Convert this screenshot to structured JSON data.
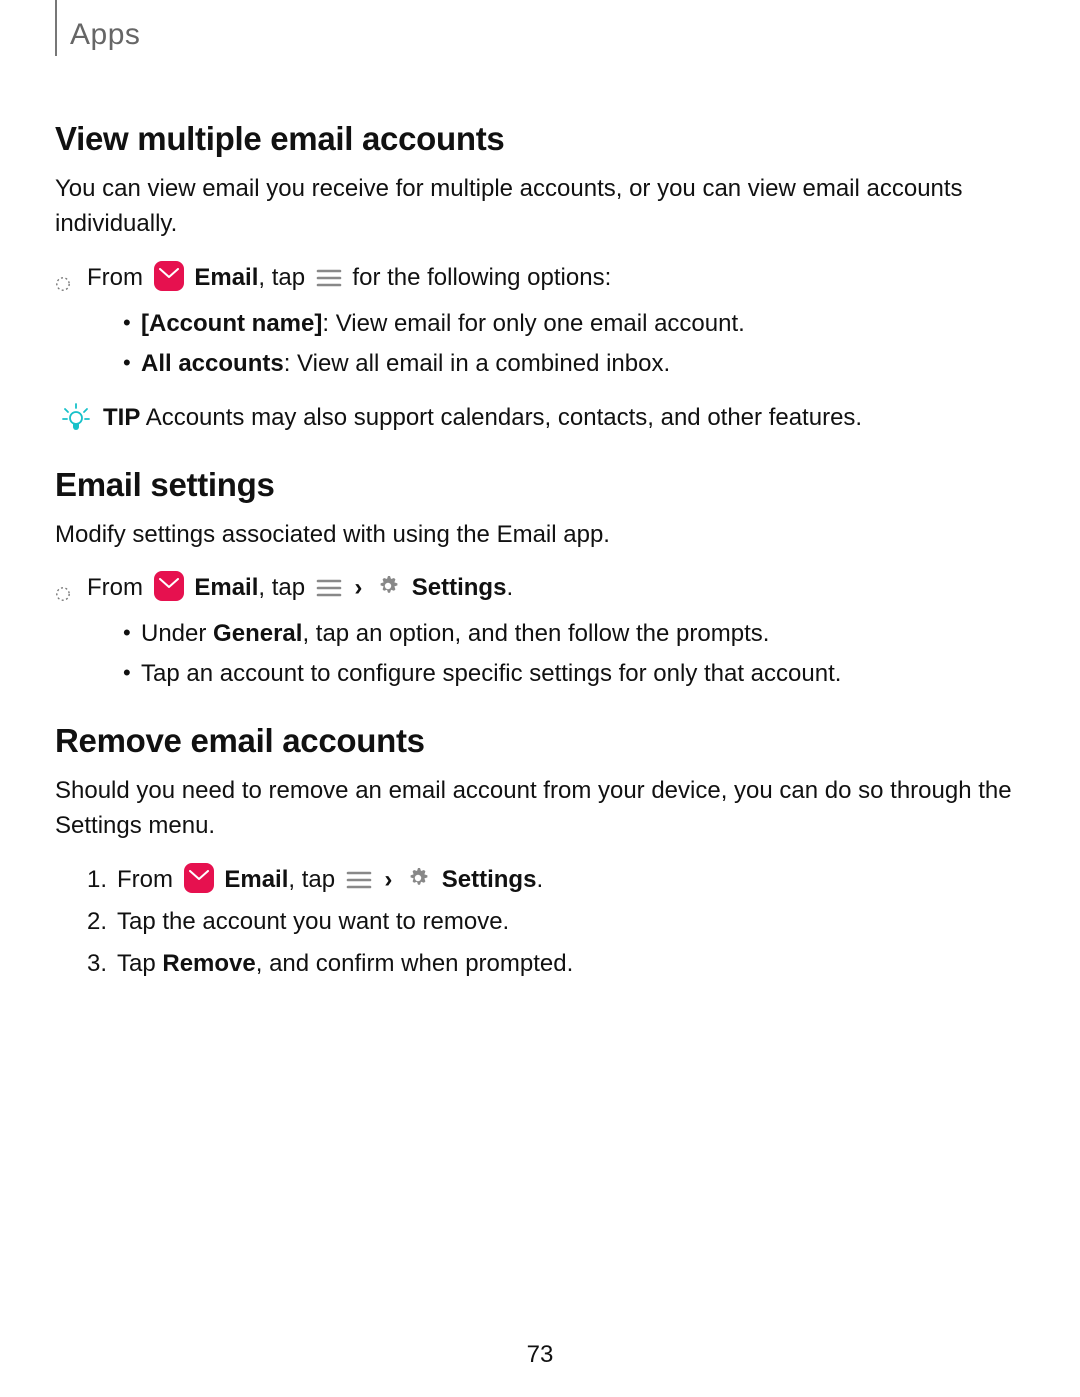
{
  "breadcrumb": "Apps",
  "page_number": "73",
  "tip_label": "TIP",
  "chevron": "›",
  "sections": {
    "view": {
      "title": "View multiple email accounts",
      "intro": "You can view email you receive for multiple accounts, or you can view email accounts individually.",
      "instr_pre": "From ",
      "instr_app": "Email",
      "instr_mid": ", tap ",
      "instr_post": " for the following options:",
      "bullets": [
        {
          "lead": "[Account name]",
          "rest": ": View email for only one email account."
        },
        {
          "lead": "All accounts",
          "rest": ": View all email in a combined inbox."
        }
      ],
      "tip": "Accounts may also support calendars, contacts, and other features."
    },
    "settings": {
      "title": "Email settings",
      "intro": "Modify settings associated with using the Email app.",
      "instr_pre": "From ",
      "instr_app": "Email",
      "instr_mid": ", tap ",
      "instr_settings": "Settings",
      "instr_end": ".",
      "bullets": [
        {
          "lead": "",
          "rest_pre": "Under ",
          "rest_b": "General",
          "rest_post": ", tap an option, and then follow the prompts."
        },
        {
          "lead": "",
          "rest_pre": "",
          "rest_b": "",
          "rest_post": "Tap an account to configure specific settings for only that account."
        }
      ]
    },
    "remove": {
      "title": "Remove email accounts",
      "intro": "Should you need to remove an email account from your device, you can do so through the Settings menu.",
      "steps": [
        {
          "pre": "From ",
          "app": "Email",
          "mid": ", tap ",
          "settings": "Settings",
          "end": "."
        },
        {
          "text": "Tap the account you want to remove."
        },
        {
          "pre": "Tap ",
          "b": "Remove",
          "post": ", and confirm when prompted."
        }
      ]
    }
  }
}
